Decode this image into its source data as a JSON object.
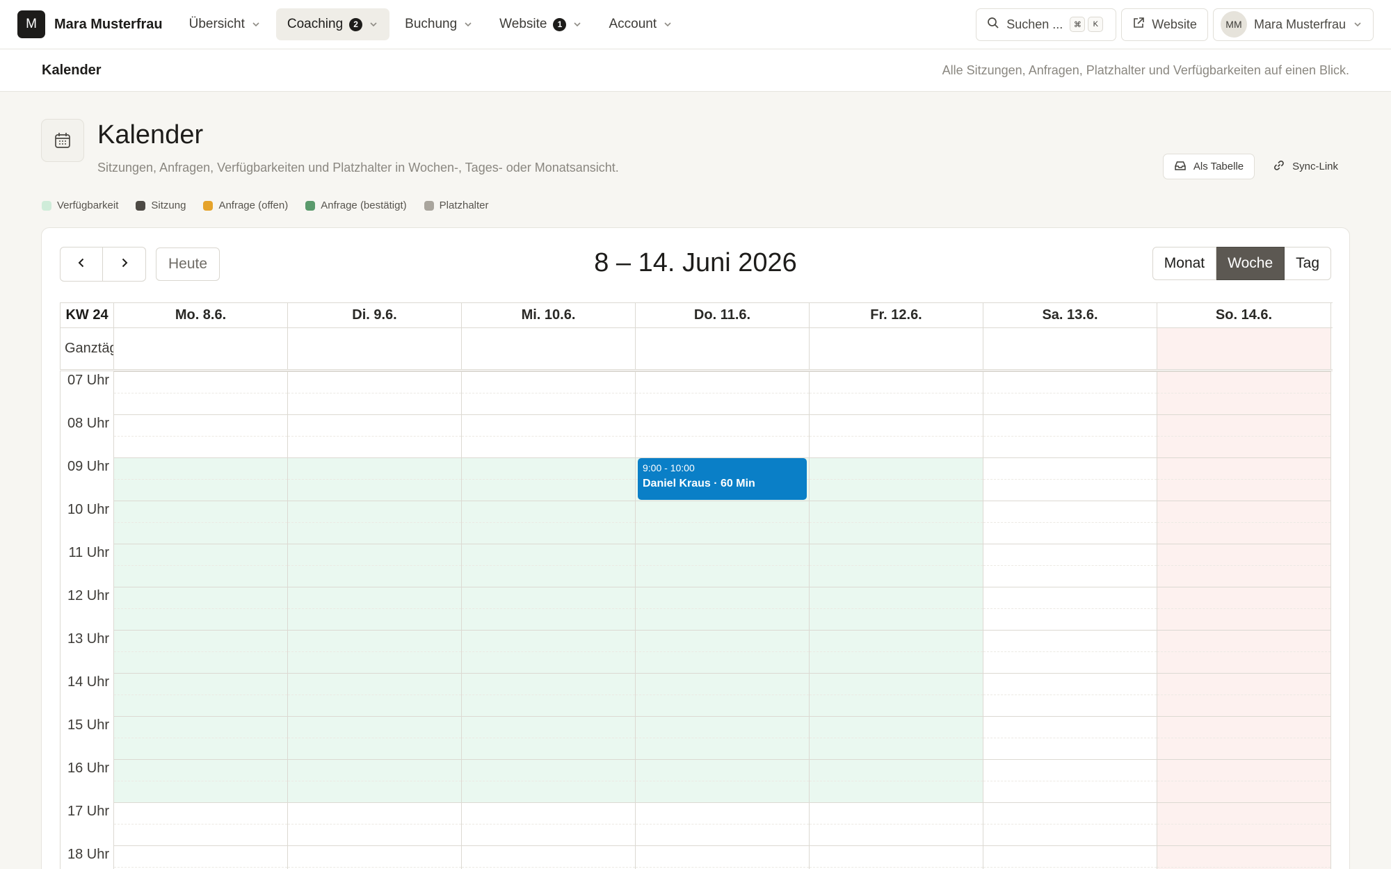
{
  "nav": {
    "brand_initial": "M",
    "brand_name": "Mara Musterfrau",
    "items": [
      {
        "label": "Übersicht",
        "badge": ""
      },
      {
        "label": "Coaching",
        "badge": "2"
      },
      {
        "label": "Buchung",
        "badge": ""
      },
      {
        "label": "Website",
        "badge": "1"
      },
      {
        "label": "Account",
        "badge": ""
      }
    ],
    "search_label": "Suchen ...",
    "search_kbd": [
      "⌘",
      "K"
    ],
    "website_label": "Website",
    "user_initials": "MM",
    "user_name": "Mara Musterfrau"
  },
  "subheader": {
    "title": "Kalender",
    "description": "Alle Sitzungen, Anfragen, Platzhalter und Verfügbarkeiten auf einen Blick."
  },
  "page": {
    "title": "Kalender",
    "subtitle": "Sitzungen, Anfragen, Verfügbarkeiten und Platzhalter in Wochen-, Tages- oder Monatsansicht.",
    "table_button": "Als Tabelle",
    "sync_button": "Sync-Link"
  },
  "legend": [
    {
      "label": "Verfügbarkeit",
      "color": "#cfecd9"
    },
    {
      "label": "Sitzung",
      "color": "#4d4a45"
    },
    {
      "label": "Anfrage (offen)",
      "color": "#e5a32b"
    },
    {
      "label": "Anfrage (bestätigt)",
      "color": "#5a9a6c"
    },
    {
      "label": "Platzhalter",
      "color": "#a9a59d"
    }
  ],
  "calendar": {
    "range_title": "8 – 14. Juni 2026",
    "today_button": "Heute",
    "views": [
      "Monat",
      "Woche",
      "Tag"
    ],
    "active_view": "Woche",
    "week_label": "KW 24",
    "allday_label": "Ganztägig",
    "days": [
      "Mo. 8.6.",
      "Di. 9.6.",
      "Mi. 10.6.",
      "Do. 11.6.",
      "Fr. 12.6.",
      "Sa. 13.6.",
      "So. 14.6."
    ],
    "hours": [
      "07 Uhr",
      "08 Uhr",
      "09 Uhr",
      "10 Uhr",
      "11 Uhr",
      "12 Uhr",
      "13 Uhr",
      "14 Uhr",
      "15 Uhr",
      "16 Uhr",
      "17 Uhr",
      "18 Uhr"
    ],
    "availability": {
      "days": [
        0,
        1,
        2,
        3,
        4
      ],
      "from_hour": 9,
      "to_hour": 17
    },
    "events": [
      {
        "day": 3,
        "start": "9:00",
        "end": "10:00",
        "time_label": "9:00 - 10:00",
        "title": "Daniel Kraus · 60 Min"
      }
    ],
    "colors": {
      "event": "#0a7fc7",
      "availability": "#eaf8f0",
      "sunday": "#fdf1ef"
    }
  }
}
